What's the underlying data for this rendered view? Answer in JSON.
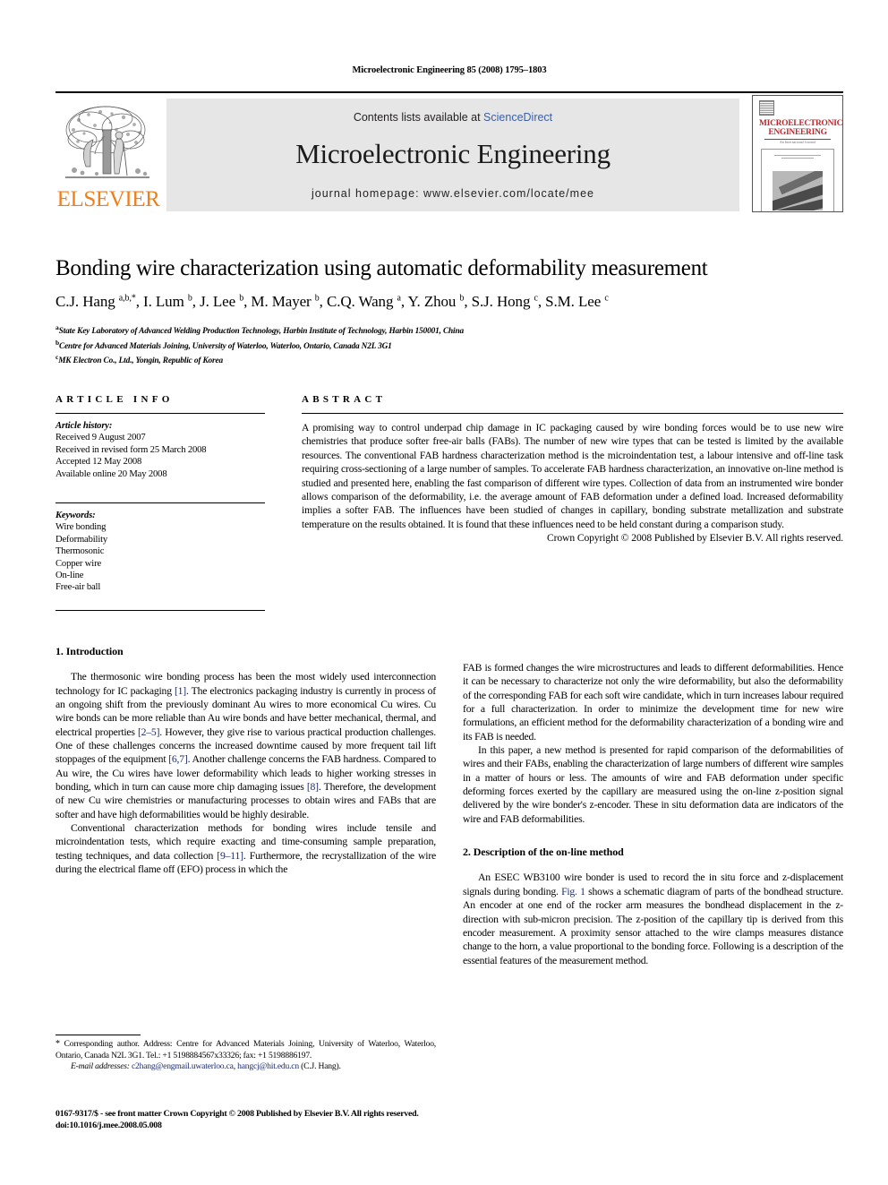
{
  "running_head": "Microelectronic Engineering 85 (2008) 1795–1803",
  "masthead": {
    "contents_prefix": "Contents lists available at ",
    "sciencedirect": "ScienceDirect",
    "journal_title": "Microelectronic Engineering",
    "homepage": "journal homepage: www.elsevier.com/locate/mee",
    "publisher_wordmark": "ELSEVIER",
    "cover_title_line1": "MICROELECTRONIC",
    "cover_title_line2": "ENGINEERING",
    "cover_subtitle": "An International Journal",
    "accent_orange": "#F07F1A",
    "accent_red": "#c1272d",
    "accent_link": "#3b5ea8",
    "banner_bg": "#e6e6e6"
  },
  "article": {
    "title": "Bonding wire characterization using automatic deformability measurement",
    "authors_html": "C.J. Hang <sup>a,b,</sup><sup>*</sup>, I. Lum <sup>b</sup>, J. Lee <sup>b</sup>, M. Mayer <sup>b</sup>, C.Q. Wang <sup>a</sup>, Y. Zhou <sup>b</sup>, S.J. Hong <sup>c</sup>, S.M. Lee <sup>c</sup>",
    "affiliations": [
      {
        "mark": "a",
        "text": "State Key Laboratory of Advanced Welding Production Technology, Harbin Institute of Technology, Harbin 150001, China"
      },
      {
        "mark": "b",
        "text": "Centre for Advanced Materials Joining, University of Waterloo, Waterloo, Ontario, Canada N2L 3G1"
      },
      {
        "mark": "c",
        "text": "MK Electron Co., Ltd., Yongin, Republic of Korea"
      }
    ]
  },
  "article_info": {
    "heading": "ARTICLE INFO",
    "history_label": "Article history:",
    "history": [
      "Received 9 August 2007",
      "Received in revised form 25 March 2008",
      "Accepted 12 May 2008",
      "Available online 20 May 2008"
    ],
    "keywords_label": "Keywords:",
    "keywords": [
      "Wire bonding",
      "Deformability",
      "Thermosonic",
      "Copper wire",
      "On-line",
      "Free-air ball"
    ]
  },
  "abstract": {
    "heading": "ABSTRACT",
    "text": "A promising way to control underpad chip damage in IC packaging caused by wire bonding forces would be to use new wire chemistries that produce softer free-air balls (FABs). The number of new wire types that can be tested is limited by the available resources. The conventional FAB hardness characterization method is the microindentation test, a labour intensive and off-line task requiring cross-sectioning of a large number of samples. To accelerate FAB hardness characterization, an innovative on-line method is studied and presented here, enabling the fast comparison of different wire types. Collection of data from an instrumented wire bonder allows comparison of the deformability, i.e. the average amount of FAB deformation under a defined load. Increased deformability implies a softer FAB. The influences have been studied of changes in capillary, bonding substrate metallization and substrate temperature on the results obtained. It is found that these influences need to be held constant during a comparison study.",
    "copyright": "Crown Copyright © 2008 Published by Elsevier B.V. All rights reserved."
  },
  "sections": {
    "intro_heading": "1. Introduction",
    "method_heading": "2. Description of the on-line method"
  },
  "body": {
    "p1_a": "The thermosonic wire bonding process has been the most widely used interconnection technology for IC packaging ",
    "p1_r1": "[1]",
    "p1_b": ". The electronics packaging industry is currently in process of an ongoing shift from the previously dominant Au wires to more economical Cu wires. Cu wire bonds can be more reliable than Au wire bonds and have better mechanical, thermal, and electrical properties ",
    "p1_r2": "[2–5]",
    "p1_c": ". However, they give rise to various practical production challenges. One of these challenges concerns the increased downtime caused by more frequent tail lift stoppages of the equipment ",
    "p1_r3": "[6,7]",
    "p1_d": ". Another challenge concerns the FAB hardness. Compared to Au wire, the Cu wires have lower deformability which leads to higher working stresses in bonding, which in turn can cause more chip damaging issues ",
    "p1_r4": "[8]",
    "p1_e": ". Therefore, the development of new Cu wire chemistries or manufacturing processes to obtain wires and FABs that are softer and have high deformabilities would be highly desirable.",
    "p2_a": "Conventional characterization methods for bonding wires include tensile and microindentation tests, which require exacting and time-consuming sample preparation, testing techniques, and data collection ",
    "p2_r1": "[9–11]",
    "p2_b": ". Furthermore, the recrystallization of the wire during the electrical flame off (EFO) process in which the",
    "p3": "FAB is formed changes the wire microstructures and leads to different deformabilities. Hence it can be necessary to characterize not only the wire deformability, but also the deformability of the corresponding FAB for each soft wire candidate, which in turn increases labour required for a full characterization. In order to minimize the development time for new wire formulations, an efficient method for the deformability characterization of a bonding wire and its FAB is needed.",
    "p4": "In this paper, a new method is presented for rapid comparison of the deformabilities of wires and their FABs, enabling the characterization of large numbers of different wire samples in a matter of hours or less. The amounts of wire and FAB deformation under specific deforming forces exerted by the capillary are measured using the on-line z-position signal delivered by the wire bonder's z-encoder. These in situ deformation data are indicators of the wire and FAB deformabilities.",
    "p5_a": "An ESEC WB3100 wire bonder is used to record the in situ force and z-displacement signals during bonding. ",
    "p5_r1": "Fig. 1",
    "p5_b": " shows a schematic diagram of parts of the bondhead structure. An encoder at one end of the rocker arm measures the bondhead displacement in the z-direction with sub-micron precision. The z-position of the capillary tip is derived from this encoder measurement. A proximity sensor attached to the wire clamps measures distance change to the horn, a value proportional to the bonding force. Following is a description of the essential features of the measurement method."
  },
  "footnote": {
    "star": "*",
    "corresponding": " Corresponding author. Address: Centre for Advanced Materials Joining, University of Waterloo, Waterloo, Ontario, Canada N2L 3G1. Tel.: +1 5198884567x33326; fax: +1 5198886197.",
    "email_label": "E-mail addresses:",
    "email1": "c2hang@engmail.uwaterloo.ca",
    "email_sep": ", ",
    "email2": "hangcj@hit.edu.cn",
    "email_attrib": " (C.J. Hang)."
  },
  "imprint": {
    "line1": "0167-9317/$ - see front matter Crown Copyright © 2008 Published by Elsevier B.V. All rights reserved.",
    "line2": "doi:10.1016/j.mee.2008.05.008"
  }
}
